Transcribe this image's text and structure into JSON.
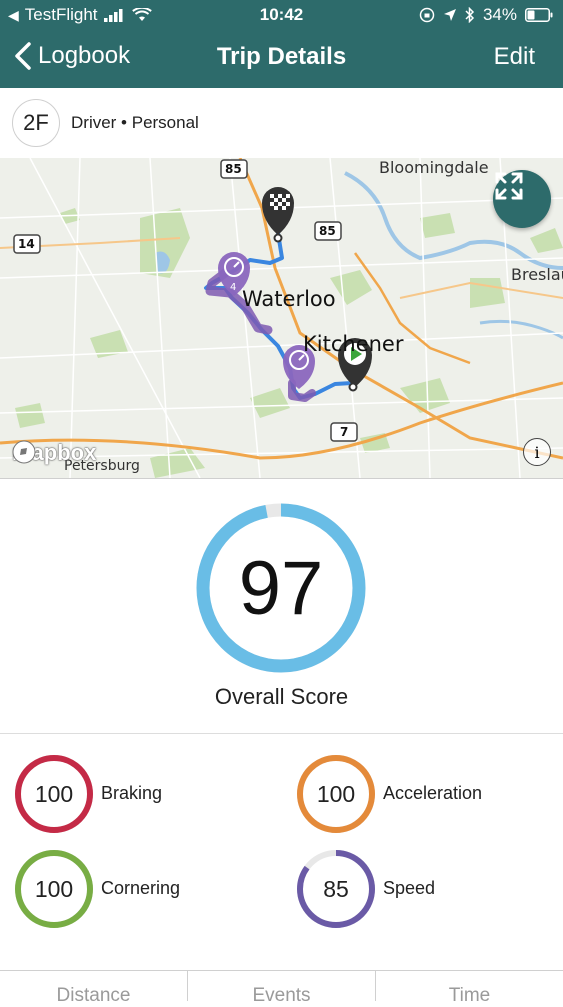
{
  "status_bar": {
    "carrier": "TestFlight",
    "time": "10:42",
    "battery": "34%"
  },
  "nav": {
    "back_label": "Logbook",
    "title": "Trip Details",
    "edit_label": "Edit"
  },
  "driver": {
    "initials": "2F",
    "role": "Driver • Personal"
  },
  "map": {
    "labels": {
      "bloomingdale": "Bloomingdale",
      "waterloo": "Waterloo",
      "kitchener": "Kitchener",
      "breslau": "Breslau",
      "petersburg": "Petersburg",
      "hwy85a": "85",
      "hwy85b": "85",
      "hwy14": "14",
      "hwy7": "7",
      "marker_count": "4"
    },
    "attribution": "mapbox",
    "info_glyph": "i"
  },
  "overall": {
    "value": "97",
    "score": 97,
    "label": "Overall Score",
    "color": "#69bde6"
  },
  "metrics": [
    {
      "value": "100",
      "score": 100,
      "label": "Braking",
      "color": "#c42a46"
    },
    {
      "value": "100",
      "score": 100,
      "label": "Acceleration",
      "color": "#e48a3a"
    },
    {
      "value": "100",
      "score": 100,
      "label": "Cornering",
      "color": "#78ad44"
    },
    {
      "value": "85",
      "score": 85,
      "label": "Speed",
      "color": "#6a5aa6"
    }
  ],
  "tabs": [
    "Distance",
    "Events",
    "Time"
  ],
  "icons": {
    "back": "chevron-left-icon",
    "expand": "expand-arrows-icon",
    "start": "play-marker-icon",
    "finish": "checkered-flag-marker-icon",
    "speed": "speedometer-marker-icon"
  }
}
